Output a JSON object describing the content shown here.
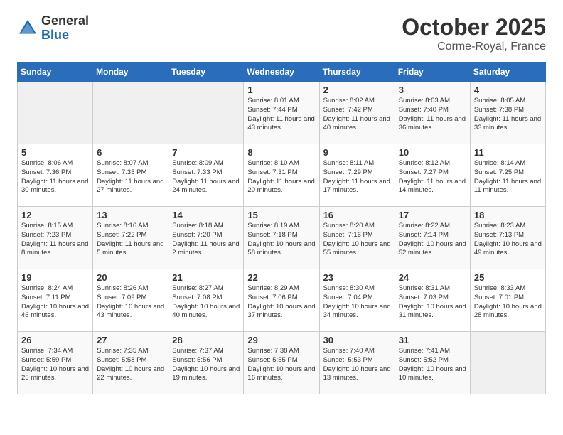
{
  "header": {
    "logo_general": "General",
    "logo_blue": "Blue",
    "month": "October 2025",
    "location": "Corme-Royal, France"
  },
  "days_of_week": [
    "Sunday",
    "Monday",
    "Tuesday",
    "Wednesday",
    "Thursday",
    "Friday",
    "Saturday"
  ],
  "weeks": [
    [
      {
        "day": "",
        "empty": true
      },
      {
        "day": "",
        "empty": true
      },
      {
        "day": "",
        "empty": true
      },
      {
        "day": "1",
        "sunrise": "8:01 AM",
        "sunset": "7:44 PM",
        "daylight": "11 hours and 43 minutes."
      },
      {
        "day": "2",
        "sunrise": "8:02 AM",
        "sunset": "7:42 PM",
        "daylight": "11 hours and 40 minutes."
      },
      {
        "day": "3",
        "sunrise": "8:03 AM",
        "sunset": "7:40 PM",
        "daylight": "11 hours and 36 minutes."
      },
      {
        "day": "4",
        "sunrise": "8:05 AM",
        "sunset": "7:38 PM",
        "daylight": "11 hours and 33 minutes."
      }
    ],
    [
      {
        "day": "5",
        "sunrise": "8:06 AM",
        "sunset": "7:36 PM",
        "daylight": "11 hours and 30 minutes."
      },
      {
        "day": "6",
        "sunrise": "8:07 AM",
        "sunset": "7:35 PM",
        "daylight": "11 hours and 27 minutes."
      },
      {
        "day": "7",
        "sunrise": "8:09 AM",
        "sunset": "7:33 PM",
        "daylight": "11 hours and 24 minutes."
      },
      {
        "day": "8",
        "sunrise": "8:10 AM",
        "sunset": "7:31 PM",
        "daylight": "11 hours and 20 minutes."
      },
      {
        "day": "9",
        "sunrise": "8:11 AM",
        "sunset": "7:29 PM",
        "daylight": "11 hours and 17 minutes."
      },
      {
        "day": "10",
        "sunrise": "8:12 AM",
        "sunset": "7:27 PM",
        "daylight": "11 hours and 14 minutes."
      },
      {
        "day": "11",
        "sunrise": "8:14 AM",
        "sunset": "7:25 PM",
        "daylight": "11 hours and 11 minutes."
      }
    ],
    [
      {
        "day": "12",
        "sunrise": "8:15 AM",
        "sunset": "7:23 PM",
        "daylight": "11 hours and 8 minutes."
      },
      {
        "day": "13",
        "sunrise": "8:16 AM",
        "sunset": "7:22 PM",
        "daylight": "11 hours and 5 minutes."
      },
      {
        "day": "14",
        "sunrise": "8:18 AM",
        "sunset": "7:20 PM",
        "daylight": "11 hours and 2 minutes."
      },
      {
        "day": "15",
        "sunrise": "8:19 AM",
        "sunset": "7:18 PM",
        "daylight": "10 hours and 58 minutes."
      },
      {
        "day": "16",
        "sunrise": "8:20 AM",
        "sunset": "7:16 PM",
        "daylight": "10 hours and 55 minutes."
      },
      {
        "day": "17",
        "sunrise": "8:22 AM",
        "sunset": "7:14 PM",
        "daylight": "10 hours and 52 minutes."
      },
      {
        "day": "18",
        "sunrise": "8:23 AM",
        "sunset": "7:13 PM",
        "daylight": "10 hours and 49 minutes."
      }
    ],
    [
      {
        "day": "19",
        "sunrise": "8:24 AM",
        "sunset": "7:11 PM",
        "daylight": "10 hours and 46 minutes."
      },
      {
        "day": "20",
        "sunrise": "8:26 AM",
        "sunset": "7:09 PM",
        "daylight": "10 hours and 43 minutes."
      },
      {
        "day": "21",
        "sunrise": "8:27 AM",
        "sunset": "7:08 PM",
        "daylight": "10 hours and 40 minutes."
      },
      {
        "day": "22",
        "sunrise": "8:29 AM",
        "sunset": "7:06 PM",
        "daylight": "10 hours and 37 minutes."
      },
      {
        "day": "23",
        "sunrise": "8:30 AM",
        "sunset": "7:04 PM",
        "daylight": "10 hours and 34 minutes."
      },
      {
        "day": "24",
        "sunrise": "8:31 AM",
        "sunset": "7:03 PM",
        "daylight": "10 hours and 31 minutes."
      },
      {
        "day": "25",
        "sunrise": "8:33 AM",
        "sunset": "7:01 PM",
        "daylight": "10 hours and 28 minutes."
      }
    ],
    [
      {
        "day": "26",
        "sunrise": "7:34 AM",
        "sunset": "5:59 PM",
        "daylight": "10 hours and 25 minutes."
      },
      {
        "day": "27",
        "sunrise": "7:35 AM",
        "sunset": "5:58 PM",
        "daylight": "10 hours and 22 minutes."
      },
      {
        "day": "28",
        "sunrise": "7:37 AM",
        "sunset": "5:56 PM",
        "daylight": "10 hours and 19 minutes."
      },
      {
        "day": "29",
        "sunrise": "7:38 AM",
        "sunset": "5:55 PM",
        "daylight": "10 hours and 16 minutes."
      },
      {
        "day": "30",
        "sunrise": "7:40 AM",
        "sunset": "5:53 PM",
        "daylight": "10 hours and 13 minutes."
      },
      {
        "day": "31",
        "sunrise": "7:41 AM",
        "sunset": "5:52 PM",
        "daylight": "10 hours and 10 minutes."
      },
      {
        "day": "",
        "empty": true
      }
    ]
  ]
}
